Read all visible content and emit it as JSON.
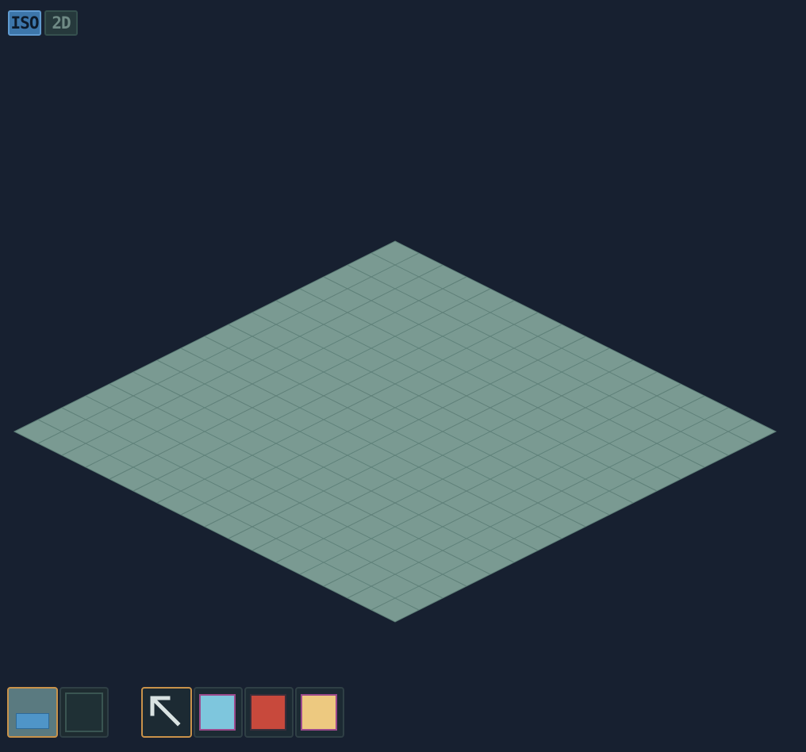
{
  "view_toggle": {
    "iso_label": "ISO",
    "flat_label": "2D",
    "active": "ISO"
  },
  "board": {
    "rows": 16,
    "cols": 16,
    "tile_color": "#7a9a92",
    "grid_line_color": "#5e7f78"
  },
  "layers": [
    {
      "name": "layer-floor",
      "selected": true,
      "fill": "#5a7a80",
      "marker": "#4f95c8"
    },
    {
      "name": "layer-empty",
      "selected": false,
      "fill": "#1f3035",
      "marker": ""
    }
  ],
  "tools": {
    "pointer": {
      "icon": "cursor-arrow-icon",
      "selected": true
    },
    "colors": [
      {
        "name": "light-blue",
        "hex": "#7ec6dd",
        "border": "#9b4a8c"
      },
      {
        "name": "red",
        "hex": "#c8493c",
        "border": "#3b2e3a"
      },
      {
        "name": "yellow",
        "hex": "#edc980",
        "border": "#9b4a8c"
      }
    ]
  },
  "colors": {
    "background": "#172030",
    "accent_selected": "#c9924a"
  }
}
